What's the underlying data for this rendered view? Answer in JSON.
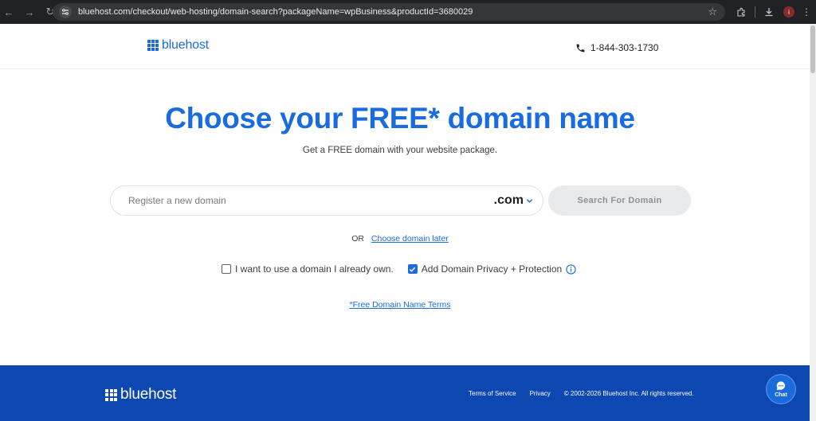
{
  "browser": {
    "url": "bluehost.com/checkout/web-hosting/domain-search?packageName=wpBusiness&productId=3680029",
    "profile_initial": "i",
    "icons": [
      "back-icon",
      "forward-icon",
      "reload-icon",
      "site-info-icon",
      "bookmark-star-icon",
      "extensions-icon",
      "download-icon",
      "menu-icon"
    ]
  },
  "header": {
    "logo_text": "bluehost",
    "phone": "1-844-303-1730"
  },
  "hero": {
    "title": "Choose your FREE* domain name",
    "subtitle": "Get a FREE domain with your website package."
  },
  "search": {
    "placeholder": "Register a new domain",
    "value": "",
    "tld": ".com",
    "button_label": "Search For Domain"
  },
  "alt_option": {
    "or_text": "OR",
    "link_label": "Choose domain later"
  },
  "options": {
    "own_domain_label": "I want to use a domain I already own.",
    "own_domain_checked": false,
    "privacy_label": "Add Domain Privacy + Protection",
    "privacy_checked": true
  },
  "terms_link": "*Free Domain Name Terms",
  "footer": {
    "logo_text": "bluehost",
    "terms_label": "Terms of Service",
    "privacy_label": "Privacy",
    "copyright": "© 2002-2026 Bluehost Inc. All rights reserved.",
    "chat_label": "Chat"
  },
  "colors": {
    "brand_blue": "#196bde",
    "footer_blue": "#0c47b2"
  }
}
